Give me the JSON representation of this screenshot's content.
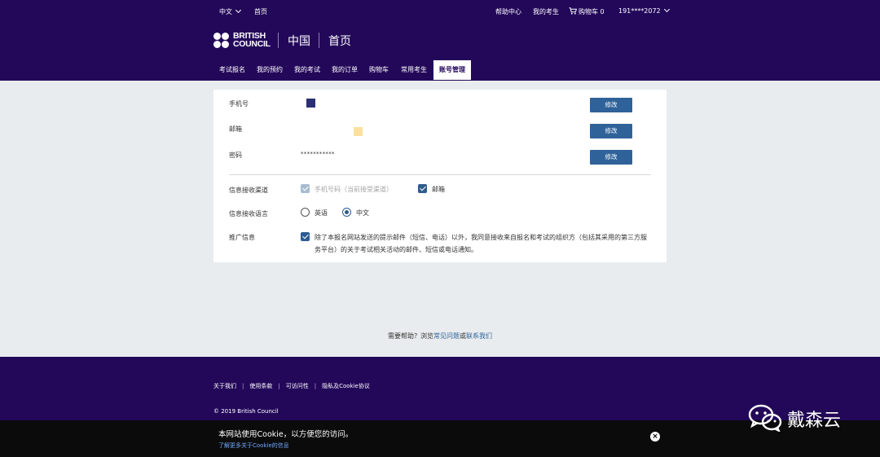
{
  "header": {
    "language": "中文",
    "home_link": "首页",
    "help_center": "帮助中心",
    "my_candidates": "我的考生",
    "cart_label": "购物车 0",
    "account": "191****2072",
    "brand_line1": "BRITISH",
    "brand_line2": "COUNCIL",
    "region": "中国",
    "page_title": "首页"
  },
  "nav": {
    "items": [
      "考试报名",
      "我的预约",
      "我的考试",
      "我的订单",
      "购物车",
      "常用考生",
      "账号管理"
    ],
    "active_index": 6
  },
  "account": {
    "phone_label": "手机号",
    "email_label": "邮箱",
    "password_label": "密码",
    "password_value": "***********",
    "edit_label": "修改",
    "phone_mask_color": "#2b2f73",
    "email_mask_color": "#fbe19c",
    "channel_label": "信息接收渠道",
    "channel_phone": "手机号码（当前接受渠道）",
    "channel_email": "邮箱",
    "language_label": "信息接收语言",
    "lang_english": "英语",
    "lang_chinese": "中文",
    "selected_language": "中文",
    "promo_label": "推广信息",
    "promo_text": "除了本报名网站发送的提示邮件（短信、电话）以外，我同意接收来自报名和考试的组织方（包括其采用的第三方服务平台）的关于考试相关活动的邮件、短信或电话通知。"
  },
  "help": {
    "prefix": "需要帮助？浏览",
    "faq": "常见问题",
    "or": "或",
    "contact": "联系我们"
  },
  "footer": {
    "links": [
      "关于我们",
      "使用条款",
      "可访问性",
      "隐私及Cookie协议"
    ],
    "copyright": "© 2019 British Council"
  },
  "cookie": {
    "message": "本网站使用Cookie，以方便您的访问。",
    "link": "了解更多关于Cookie的信息",
    "close": "×"
  },
  "watermark": {
    "text": "戴森云",
    "icon": "wechat-icon"
  },
  "colors": {
    "brand_purple": "#23085a",
    "button_blue": "#2f6299",
    "checkbox_blue": "#2f5c8f"
  }
}
